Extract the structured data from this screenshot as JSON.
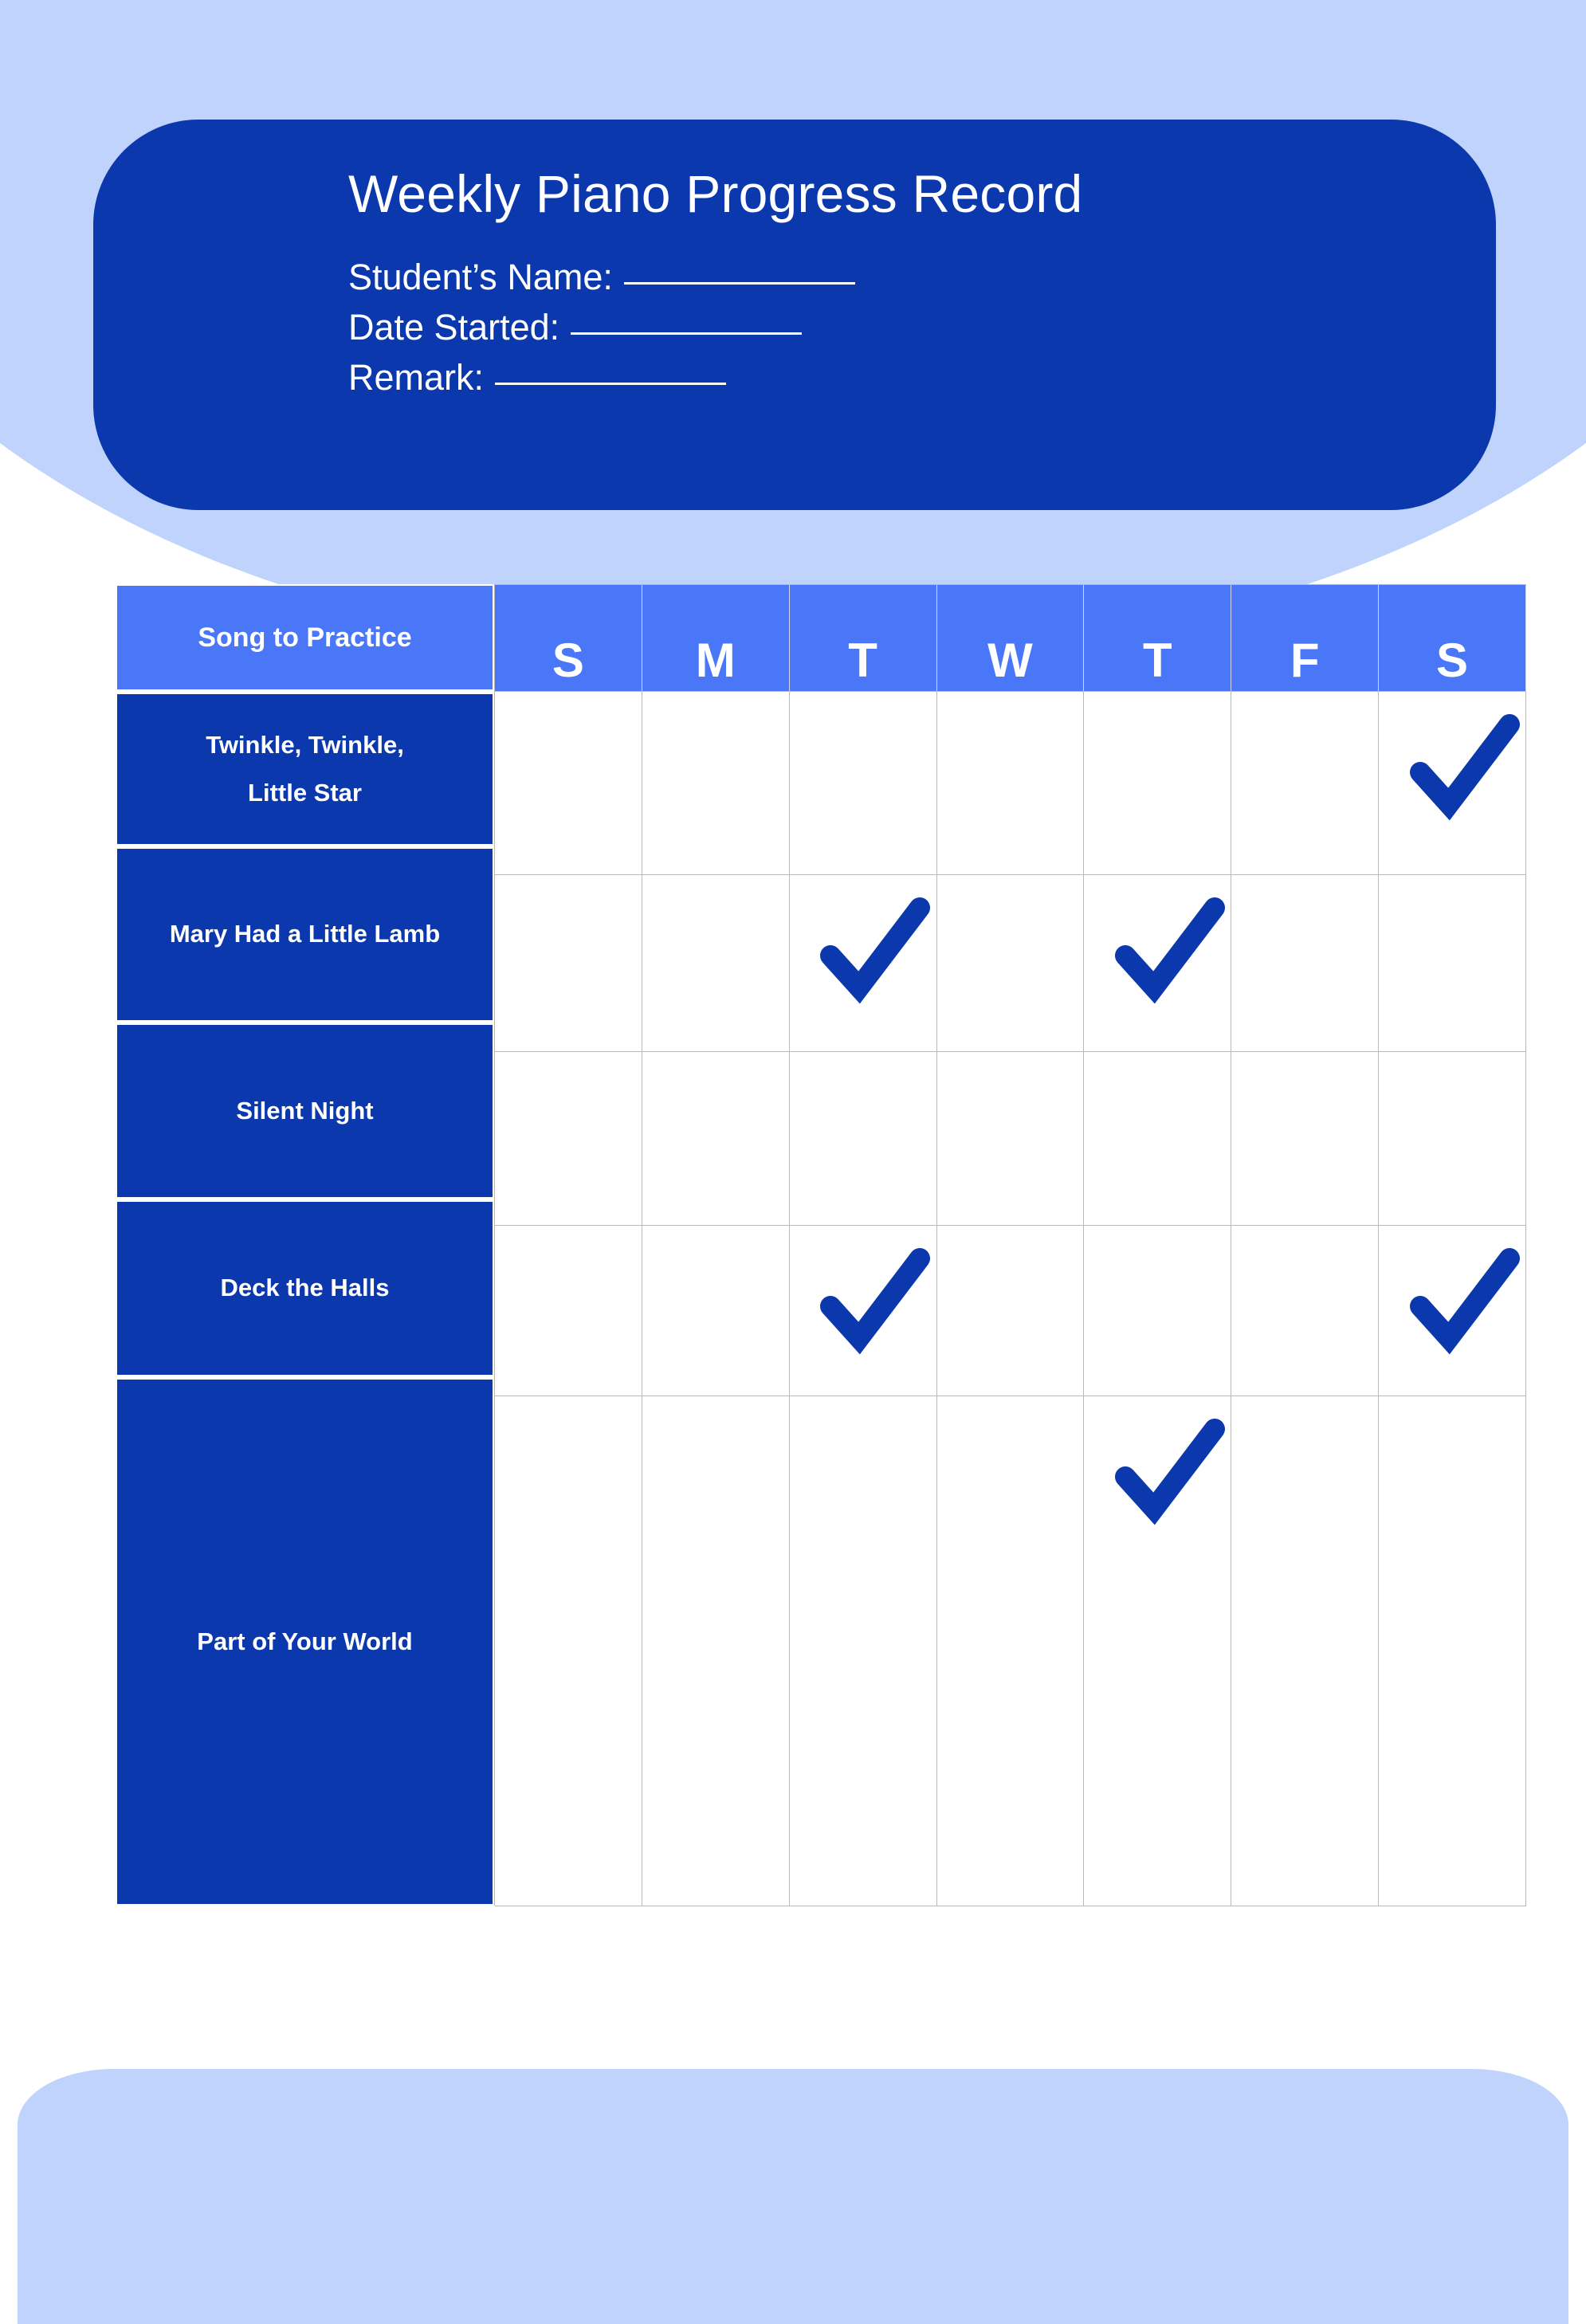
{
  "colors": {
    "bg_light_blue": "#bfd3fc",
    "dark_blue": "#0b38ad",
    "header_blue": "#4a76f8",
    "grid_line": "#b8b8b8",
    "white": "#ffffff"
  },
  "header": {
    "title": "Weekly Piano Progress Record",
    "fields": [
      {
        "label": "Student’s Name:",
        "value": ""
      },
      {
        "label": "Date Started:",
        "value": ""
      },
      {
        "label": "Remark:",
        "value": ""
      }
    ]
  },
  "table": {
    "song_column_header": "Song to Practice",
    "day_headers": [
      "S",
      "M",
      "T",
      "W",
      "T",
      "F",
      "S"
    ],
    "rows": [
      {
        "song": "Twinkle, Twinkle,",
        "song_line2": "Little Star",
        "checks": [
          false,
          false,
          false,
          false,
          false,
          false,
          true
        ]
      },
      {
        "song": "Mary Had a Little Lamb",
        "song_line2": "",
        "checks": [
          false,
          false,
          true,
          false,
          true,
          false,
          false
        ]
      },
      {
        "song": "Silent Night",
        "song_line2": "",
        "checks": [
          false,
          false,
          false,
          false,
          false,
          false,
          false
        ]
      },
      {
        "song": "Deck the Halls",
        "song_line2": "",
        "checks": [
          false,
          false,
          true,
          false,
          false,
          false,
          true
        ]
      },
      {
        "song": "Part of Your World",
        "song_line2": "",
        "checks": [
          false,
          false,
          false,
          false,
          true,
          false,
          false
        ]
      }
    ]
  },
  "checkmarks": [
    {
      "row": 0,
      "day_index": 6,
      "day": "S",
      "song": "Twinkle, Twinkle, Little Star"
    },
    {
      "row": 1,
      "day_index": 2,
      "day": "T",
      "song": "Mary Had a Little Lamb"
    },
    {
      "row": 1,
      "day_index": 4,
      "day": "T",
      "song": "Mary Had a Little Lamb"
    },
    {
      "row": 3,
      "day_index": 2,
      "day": "T",
      "song": "Deck the Halls"
    },
    {
      "row": 3,
      "day_index": 6,
      "day": "S",
      "song": "Deck the Halls"
    },
    {
      "row": 4,
      "day_index": 4,
      "day": "T",
      "song": "Part of Your World"
    }
  ]
}
